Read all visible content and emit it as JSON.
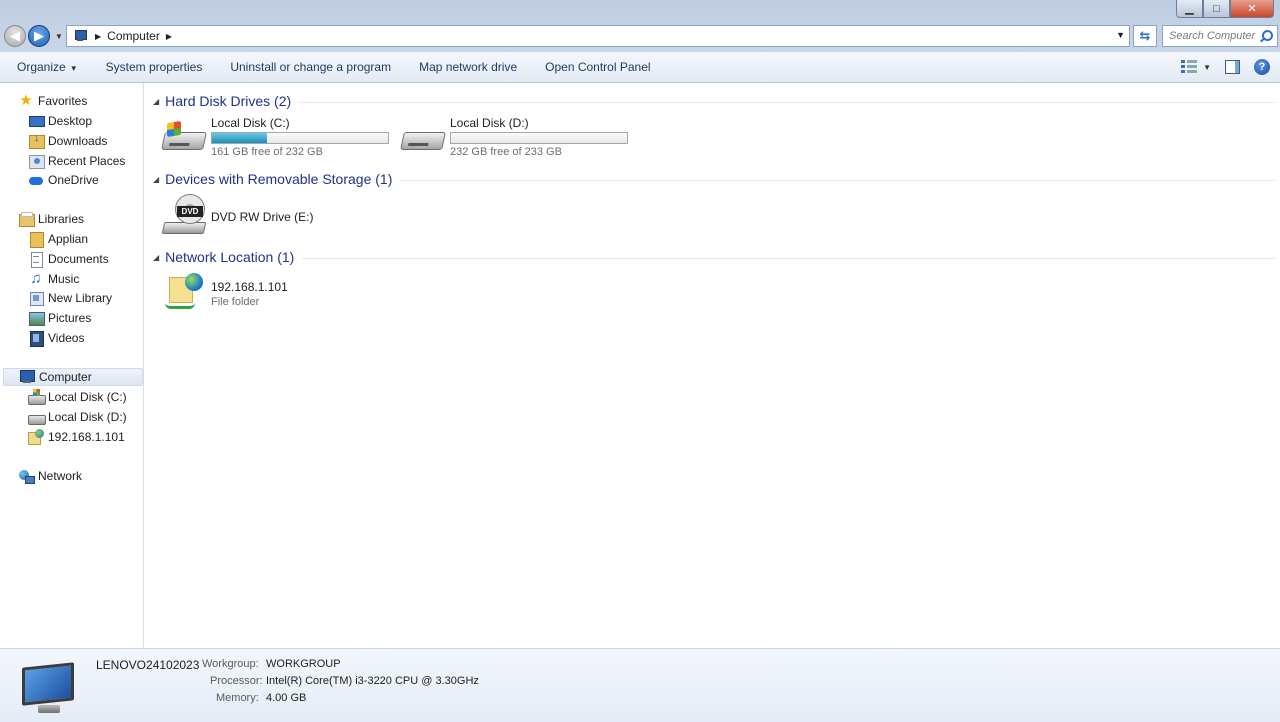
{
  "address": {
    "location": "Computer"
  },
  "search": {
    "placeholder": "Search Computer"
  },
  "window": {
    "minimize": "▁",
    "maximize": "□",
    "close": "✕"
  },
  "toolbar": {
    "organize": "Organize",
    "system_properties": "System properties",
    "uninstall": "Uninstall or change a program",
    "map_drive": "Map network drive",
    "control_panel": "Open Control Panel",
    "help": "?"
  },
  "sidebar": {
    "favorites": {
      "label": "Favorites",
      "items": [
        "Desktop",
        "Downloads",
        "Recent Places",
        "OneDrive"
      ]
    },
    "libraries": {
      "label": "Libraries",
      "items": [
        "Applian",
        "Documents",
        "Music",
        "New Library",
        "Pictures",
        "Videos"
      ]
    },
    "computer": {
      "label": "Computer",
      "items": [
        "Local Disk (C:)",
        "Local Disk (D:)",
        "192.168.1.101"
      ]
    },
    "network": {
      "label": "Network"
    }
  },
  "groups": {
    "hard_disks": "Hard Disk Drives (2)",
    "removable": "Devices with Removable Storage (1)",
    "network_location": "Network Location (1)"
  },
  "drives": [
    {
      "name": "Local Disk (C:)",
      "free_text": "161 GB free of 232 GB",
      "used_fraction": 0.31,
      "icon": "windows-hard-disk-icon"
    },
    {
      "name": "Local Disk (D:)",
      "free_text": "232 GB free of 233 GB",
      "used_fraction": 0.0,
      "icon": "hard-disk-icon"
    }
  ],
  "dvd": {
    "name": "DVD RW Drive (E:)",
    "badge": "DVD"
  },
  "netloc": {
    "name": "192.168.1.101",
    "type": "File folder"
  },
  "details": {
    "computer_name": "LENOVO24102023",
    "workgroup_label": "Workgroup:",
    "workgroup_value": "WORKGROUP",
    "processor_label": "Processor:",
    "processor_value": "Intel(R) Core(TM) i3-3220 CPU @ 3.30GHz",
    "memory_label": "Memory:",
    "memory_value": "4.00 GB"
  },
  "colors": {
    "group_header": "#1e3287",
    "toolbar_text": "#1e395b",
    "drive_fill": "#1d8fb8"
  }
}
